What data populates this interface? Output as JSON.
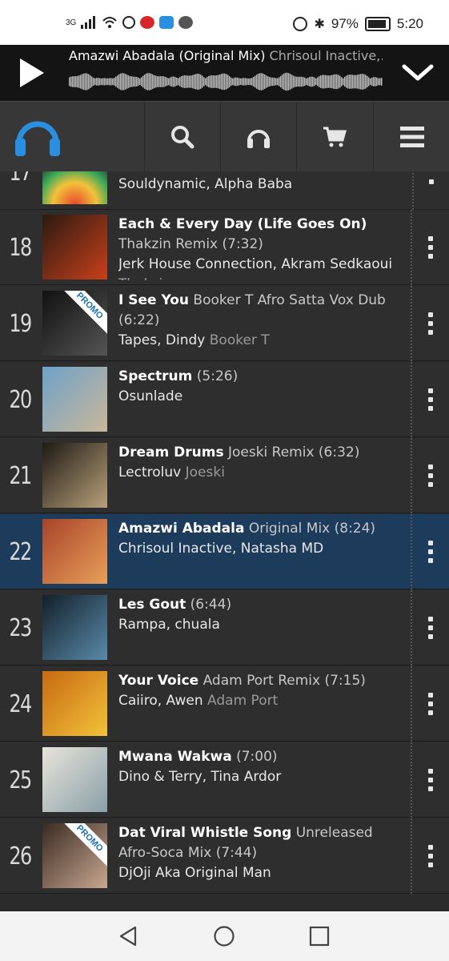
{
  "status": {
    "network": "3G",
    "battery": "97%",
    "time": "5:20"
  },
  "player": {
    "title": "Amazwi Abadala (Original Mix)",
    "artists": "Chrisoul Inactive,…",
    "play_icon": "play-icon",
    "collapse_icon": "chevron-down-icon"
  },
  "nav": {
    "logo_icon": "headphones-logo-icon",
    "items": [
      "search-icon",
      "headphones-icon",
      "cart-icon",
      "menu-icon"
    ]
  },
  "partial_top": {
    "number": "17",
    "artists": "Souldynamic, Alpha Baba"
  },
  "tracks": [
    {
      "number": "18",
      "title": "Each & Every Day (Life Goes On)",
      "mix": "Thakzin Remix (7:32)",
      "artists": "Jerk House Connection, Akram Sedkaoui",
      "remixer": "Thakzin",
      "promo": false,
      "active": false,
      "art": [
        "#2a1a12",
        "#c8401a"
      ]
    },
    {
      "number": "19",
      "title": "I See You",
      "mix": "Booker T Afro Satta Vox Dub (6:22)",
      "artists": "Tapes, Dindy",
      "remixer": "Booker T",
      "promo": true,
      "active": false,
      "art": [
        "#111111",
        "#555555"
      ]
    },
    {
      "number": "20",
      "title": "Spectrum",
      "mix": "(5:26)",
      "artists": "Osunlade",
      "remixer": "",
      "promo": false,
      "active": false,
      "art": [
        "#6fa2c8",
        "#c9b79a"
      ]
    },
    {
      "number": "21",
      "title": "Dream Drums",
      "mix": "Joeski Remix (6:32)",
      "artists": "Lectroluv",
      "remixer": "Joeski",
      "promo": false,
      "active": false,
      "art": [
        "#1e1a14",
        "#b8a07a"
      ]
    },
    {
      "number": "22",
      "title": "Amazwi Abadala",
      "mix": "Original Mix (8:24)",
      "artists": "Chrisoul Inactive, Natasha MD",
      "remixer": "",
      "promo": false,
      "active": true,
      "art": [
        "#a8432a",
        "#e8a05a"
      ]
    },
    {
      "number": "23",
      "title": "Les Gout",
      "mix": "(6:44)",
      "artists": "Rampa, chuala",
      "remixer": "",
      "promo": false,
      "active": false,
      "art": [
        "#12202a",
        "#5a8aa8"
      ]
    },
    {
      "number": "24",
      "title": "Your Voice",
      "mix": "Adam Port Remix (7:15)",
      "artists": "Caiiro, Awen",
      "remixer": "Adam Port",
      "promo": false,
      "active": false,
      "art": [
        "#c86a12",
        "#f2c23a"
      ]
    },
    {
      "number": "25",
      "title": "Mwana Wakwa",
      "mix": "(7:00)",
      "artists": "Dino & Terry, Tina Ardor",
      "remixer": "",
      "promo": false,
      "active": false,
      "art": [
        "#e8e4da",
        "#8aa0a8"
      ]
    },
    {
      "number": "26",
      "title": "Dat Viral Whistle Song",
      "mix": "Unreleased Afro-Soca Mix (7:44)",
      "artists": "DjOji Aka Original Man",
      "remixer": "",
      "promo": true,
      "active": false,
      "art": [
        "#3a2a22",
        "#c8a890"
      ]
    }
  ],
  "promo_label": "PROMO",
  "colors": {
    "accent": "#2a8fe0",
    "active_row": "#1d3b5a"
  }
}
